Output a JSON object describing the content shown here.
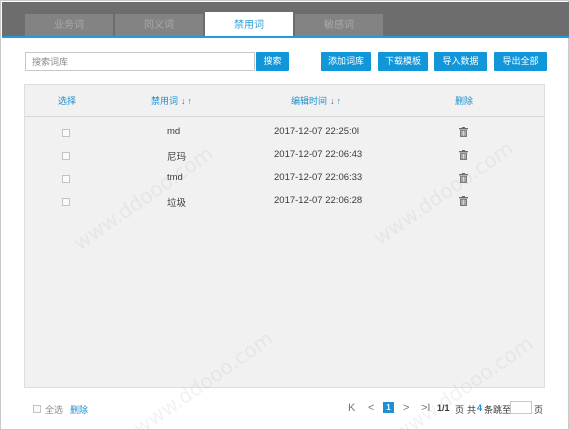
{
  "tabs": [
    {
      "label": "业务词",
      "active": false
    },
    {
      "label": "同义词",
      "active": false
    },
    {
      "label": "禁用词",
      "active": true
    },
    {
      "label": "敏感词",
      "active": false
    }
  ],
  "search": {
    "placeholder": "搜索词库",
    "button": "搜索"
  },
  "toolbar": {
    "add": "添加词库",
    "download_template": "下载模板",
    "import": "导入数据",
    "export_all": "导出全部"
  },
  "table": {
    "headers": {
      "select": "选择",
      "word": "禁用词",
      "edited": "编辑时间",
      "delete": "删除",
      "sort_down": "↓",
      "sort_up": "↑"
    },
    "rows": [
      {
        "word": "md",
        "time": "2017-12-07 22:25:0l"
      },
      {
        "word": "尼玛",
        "time": "2017-12-07 22:06:43"
      },
      {
        "word": "tmd",
        "time": "2017-12-07 22:06:33"
      },
      {
        "word": "垃圾",
        "time": "2017-12-07 22:06:28"
      }
    ]
  },
  "footer": {
    "select_all": "全选",
    "delete": "删除",
    "pager": {
      "first": "K",
      "prev": "<",
      "current": "1",
      "next": ">",
      "last": ">I",
      "pages": "1/1",
      "page_word": "页",
      "total_prefix": "共",
      "total": "4",
      "total_suffix": "条",
      "goto_prefix": "跳至",
      "goto_suffix": "页"
    }
  },
  "watermark": "www.ddooo.com",
  "colors": {
    "accent": "#1196da",
    "tab_bar": "#6d6d6d",
    "panel": "#f1f1f1"
  }
}
